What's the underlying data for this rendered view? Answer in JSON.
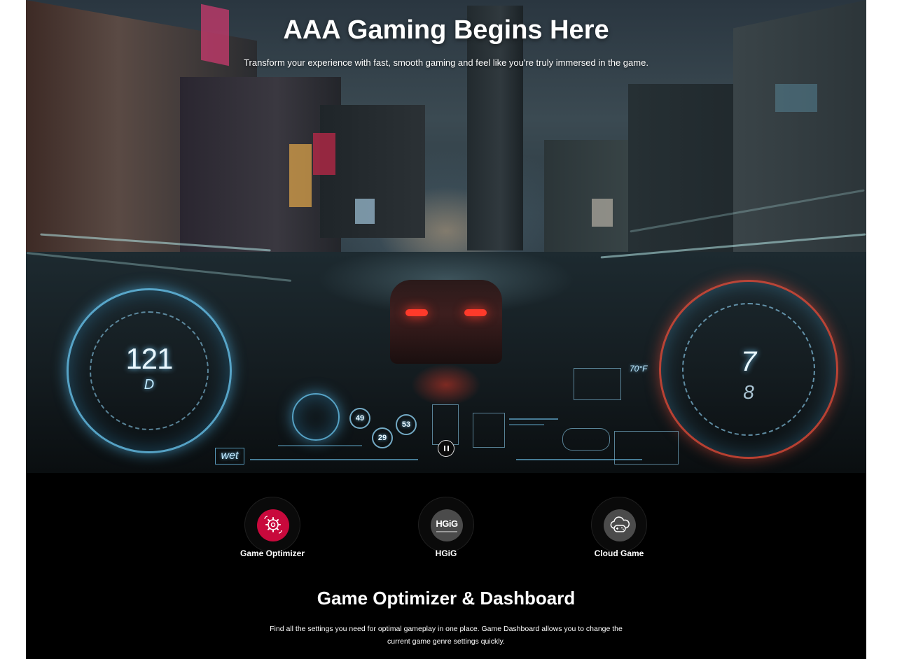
{
  "hero": {
    "title": "AAA Gaming Begins Here",
    "subtitle": "Transform your experience with fast, smooth gaming and feel like you're truly immersed in the game.",
    "hud": {
      "speed": "121",
      "gear": "D",
      "tach_gear": "7",
      "tach_sub": "8",
      "temperature": "70°F",
      "road_condition": "wet",
      "mini_values": [
        "49",
        "53",
        "29"
      ]
    },
    "pause_label": "Pause video"
  },
  "features": {
    "tabs": [
      {
        "label": "Game Optimizer",
        "icon": "gear-controller-icon",
        "color": "#c8093c"
      },
      {
        "label": "HGiG",
        "icon": "hgig-logo-icon",
        "logo_text": "HGiG",
        "color": "#4b4b4b"
      },
      {
        "label": "Cloud Game",
        "icon": "cloud-gamepad-icon",
        "color": "#4b4b4b"
      }
    ]
  },
  "section": {
    "title": "Game Optimizer & Dashboard",
    "description": "Find all the settings you need for optimal gameplay in one place. Game Dashboard allows you to change the current game genre settings quickly."
  },
  "colors": {
    "accent": "#c8093c",
    "background": "#000000",
    "text": "#ffffff"
  }
}
